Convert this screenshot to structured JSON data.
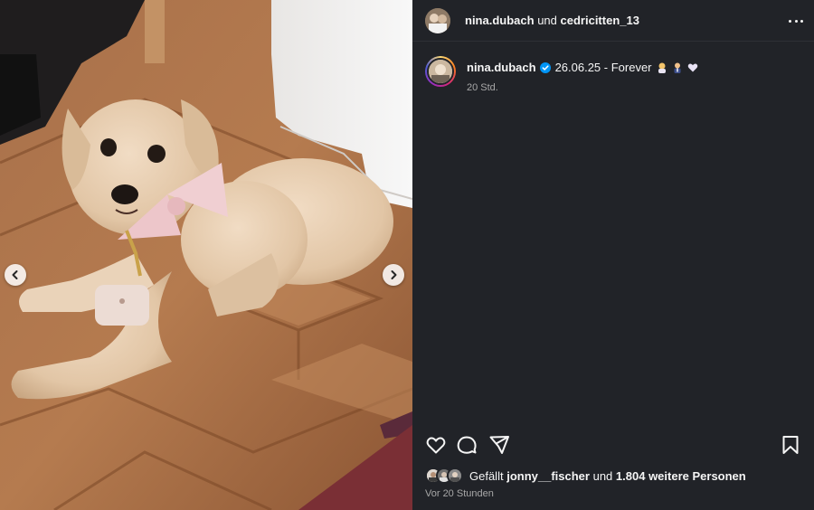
{
  "header": {
    "user_1": "nina.dubach",
    "conjunction": "und",
    "user_2": "cedricitten_13",
    "more_icon": "more-horizontal-icon"
  },
  "caption": {
    "username": "nina.dubach",
    "verified": true,
    "text": "26.06.25 - Forever",
    "emojis": [
      "bride-emoji",
      "groom-emoji",
      "white-heart-emoji"
    ],
    "time": "20 Std."
  },
  "actions": {
    "like_icon": "heart-icon",
    "comment_icon": "comment-icon",
    "share_icon": "share-icon",
    "save_icon": "bookmark-icon"
  },
  "likes": {
    "prefix": "Gefällt",
    "user": "jonny__fischer",
    "middle": "und",
    "count_text": "1.804 weitere Personen"
  },
  "post_time": "Vor 20 Stunden",
  "media": {
    "prev_icon": "chevron-left-icon",
    "next_icon": "chevron-right-icon"
  },
  "colors": {
    "panel_bg": "#212328",
    "verified": "#0095f6",
    "muted_text": "#a8a8a8"
  }
}
